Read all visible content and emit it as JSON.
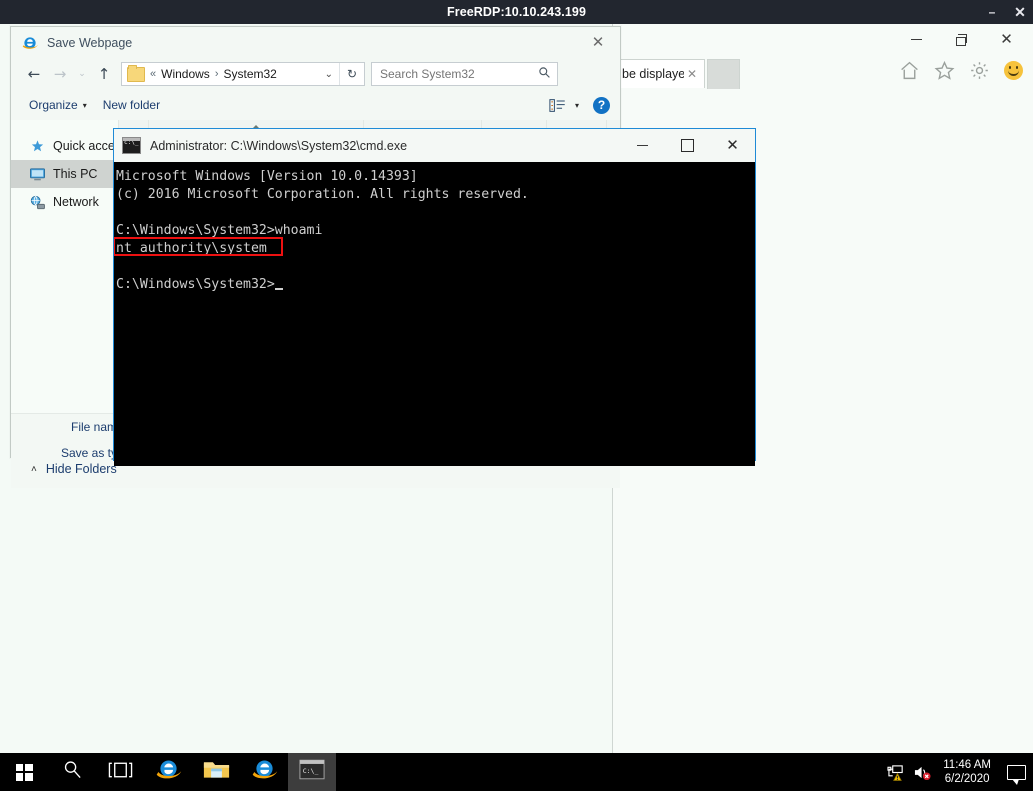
{
  "rdp": {
    "title": "FreeRDP:10.10.243.199",
    "minimize_label": "–",
    "close_label": "✕"
  },
  "browser": {
    "name": "internet-explorer",
    "tab": {
      "label": "be displayed",
      "close_label": "✕"
    },
    "new_tab_label": "",
    "toolbar_icons": [
      "home-icon",
      "favorites-star-icon",
      "settings-gear-icon",
      "smiley-icon"
    ],
    "window_controls": {
      "minimize": "minimize-icon",
      "restore": "restore-icon",
      "close": "✕"
    }
  },
  "save_dialog": {
    "title": "Save Webpage",
    "close_label": "✕",
    "nav": {
      "back_label": "←",
      "forward_label": "→",
      "recent_label": "⌄",
      "up_label": "↑",
      "refresh_label": "↻"
    },
    "breadcrumb": {
      "prefix": "«",
      "items": [
        "Windows",
        "System32"
      ],
      "separator": "›",
      "dropdown_label": "⌄"
    },
    "search": {
      "placeholder": "Search System32",
      "value": "",
      "icon_label": "⚲"
    },
    "toolbar": {
      "organize_label": "Organize",
      "organize_caret": "▾",
      "new_folder_label": "New folder",
      "view_caret": "▾",
      "help_label": "?"
    },
    "sidebar": {
      "items": [
        {
          "label": "Quick acce",
          "icon": "quick-access-star-icon",
          "selected": false
        },
        {
          "label": "This PC",
          "icon": "this-pc-monitor-icon",
          "selected": true
        },
        {
          "label": "Network",
          "icon": "network-globe-icon",
          "selected": false
        }
      ]
    },
    "file_list": {
      "columns": [
        "",
        "",
        "",
        ""
      ],
      "rows": []
    },
    "footer": {
      "file_name_label": "File nam",
      "file_name_value": "",
      "save_as_type_label": "Save as ty",
      "save_as_type_value": "",
      "hide_folders_label": "Hide Folders",
      "hide_folders_chevron": "˄"
    }
  },
  "cmd_window": {
    "title": "Administrator: C:\\Windows\\System32\\cmd.exe",
    "window_controls": {
      "minimize": "–",
      "maximize": "maximize-icon",
      "close": "✕"
    },
    "lines": [
      {
        "text": "Microsoft Windows [Version 10.0.14393]",
        "highlight": false
      },
      {
        "text": "(c) 2016 Microsoft Corporation. All rights reserved.",
        "highlight": false
      },
      {
        "text": "",
        "highlight": false
      },
      {
        "text": "C:\\Windows\\System32>whoami",
        "highlight": false
      },
      {
        "text": "nt authority\\system",
        "highlight": true
      },
      {
        "text": "",
        "highlight": false
      },
      {
        "text": "C:\\Windows\\System32>",
        "highlight": false,
        "cursor": true
      }
    ],
    "highlight_color": "#ee1111"
  },
  "taskbar": {
    "buttons": [
      {
        "name": "start-button",
        "icon": "windows-logo-icon",
        "active": false
      },
      {
        "name": "search-button",
        "icon": "search-magnifier-icon",
        "active": false
      },
      {
        "name": "task-view-button",
        "icon": "task-view-icon",
        "active": false
      },
      {
        "name": "internet-explorer-button",
        "icon": "internet-explorer-icon",
        "active": false
      },
      {
        "name": "file-explorer-button",
        "icon": "file-explorer-folder-icon",
        "active": false
      },
      {
        "name": "internet-explorer-window-button",
        "icon": "internet-explorer-icon",
        "active": false
      },
      {
        "name": "command-prompt-window-button",
        "icon": "command-prompt-icon",
        "active": true
      }
    ],
    "tray": {
      "network_icon": "network-warning-icon",
      "volume_icon": "volume-muted-icon",
      "time": "11:46 AM",
      "date": "6/2/2020",
      "notifications_icon": "action-center-icon"
    }
  },
  "colors": {
    "rdp_bar": "#22262f",
    "desktop": "#f4faf6",
    "accent_blue": "#1f8ad6",
    "taskbar": "#000000",
    "console_bg": "#000000",
    "console_fg": "#cfcfcf"
  }
}
